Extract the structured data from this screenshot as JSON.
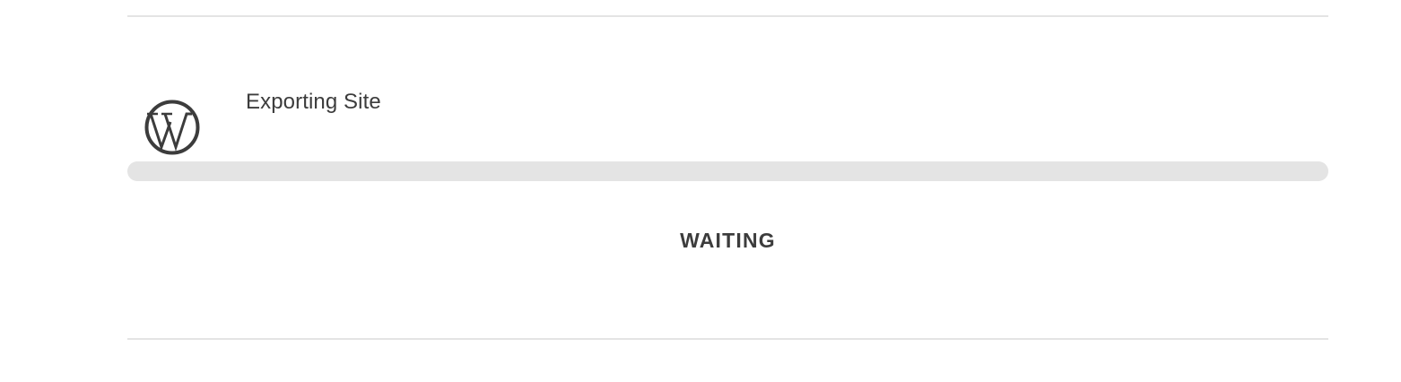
{
  "task": {
    "title": "Exporting Site",
    "icon": "wordpress-logo-icon",
    "status": "WAITING",
    "progress_percent": 0
  },
  "colors": {
    "text": "#3c3c3c",
    "track": "#e4e4e4",
    "divider": "#e4e4e4",
    "background": "#ffffff"
  }
}
